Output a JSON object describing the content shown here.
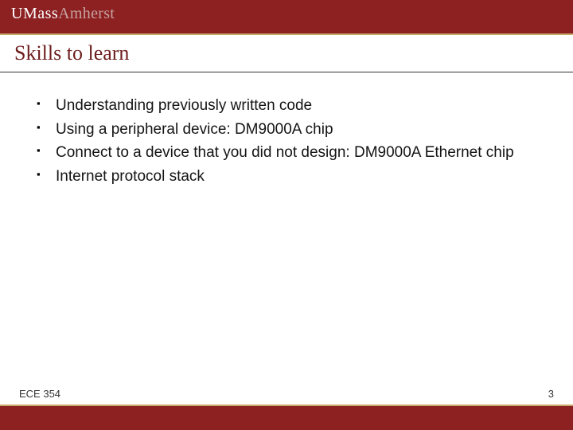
{
  "logo": {
    "word1": "UMass",
    "word2": "Amherst"
  },
  "title": "Skills to learn",
  "bullets": [
    "Understanding previously written code",
    "Using a peripheral device: DM9000A chip",
    "Connect to a device that you did not design: DM9000A Ethernet chip",
    "Internet protocol stack"
  ],
  "footer": {
    "course": "ECE 354",
    "page": "3"
  },
  "colors": {
    "brand": "#8d2021",
    "accent": "#c9a96a"
  }
}
